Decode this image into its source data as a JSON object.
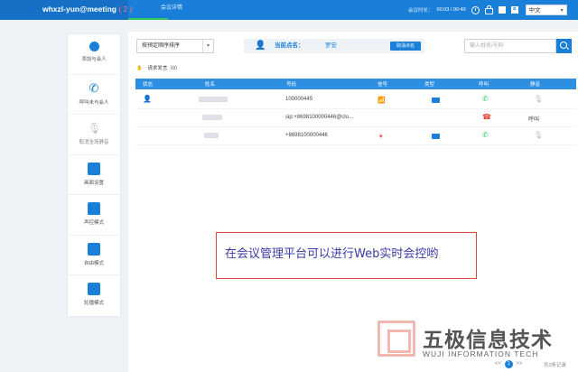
{
  "header": {
    "brand": "whxzl-yun@meeting",
    "brand_count": "( 2 )",
    "tab": "会议详情",
    "timer_label": "会议时长：",
    "timer_value": "00:03 / 00:40",
    "close_glyph": "×",
    "language": "中文",
    "colors": {
      "bar": "#1a7fd8",
      "brand_bg": "#1570c6",
      "active_tab": "#2ec95d"
    }
  },
  "tools": [
    {
      "label": "添加与会人",
      "icon": "user-plus-icon"
    },
    {
      "label": "呼叫未与会人",
      "icon": "phone-call-icon"
    },
    {
      "label": "取消全场静音",
      "icon": "mic-icon"
    },
    {
      "label": "画面设置",
      "icon": "layout-grid-icon"
    },
    {
      "label": "声控模式",
      "icon": "voice-mode-icon"
    },
    {
      "label": "自由模式",
      "icon": "free-mode-icon"
    },
    {
      "label": "轮播模式",
      "icon": "carousel-mode-icon"
    }
  ],
  "main": {
    "sort_value": "按预定顺序排序",
    "speaker_label": "当前点名：",
    "speaker_name": "罗安",
    "speaker_button": "取消点名",
    "search_placeholder": "输入姓名/号码",
    "raise_hand": "请求发言（0）",
    "columns": [
      "状态",
      "姓名",
      "号码",
      "信号",
      "类型",
      "呼叫",
      "静音"
    ],
    "rows": [
      {
        "number": "100000445",
        "signal": "wifi-green-icon",
        "type": "video-icon",
        "call": "phone-green-icon",
        "mute": "mic-icon"
      },
      {
        "number": "sip:+8698100000446@clo...",
        "call": "phone-hangup-red-icon",
        "mute": "呼叫"
      },
      {
        "number": "+8698100000446",
        "signal": "signal-red-icon",
        "type": "video-icon",
        "call": "phone-green-icon",
        "mute": "mic-icon"
      }
    ]
  },
  "annotation": "在会议管理平台可以进行Web实时会控哟",
  "watermark": {
    "cn": "五极信息技术",
    "en": "WUJI INFORMATION TECH"
  },
  "pager": {
    "prev": "<<",
    "current": "1",
    "next": ">>",
    "total": "共3条记录"
  }
}
